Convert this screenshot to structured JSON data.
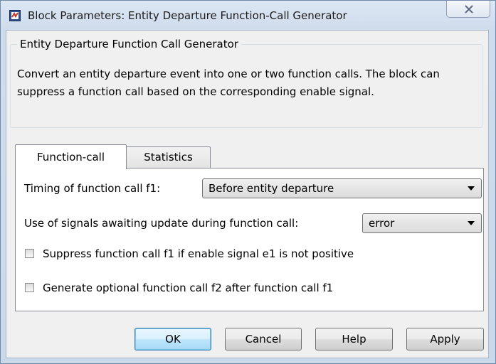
{
  "window": {
    "title": "Block Parameters: Entity Departure Function-Call Generator"
  },
  "description": {
    "group_title": "Entity Departure Function Call Generator",
    "text": "Convert an entity departure event into one or two function calls. The block can suppress a function call based on the corresponding enable signal."
  },
  "tabs": [
    {
      "label": "Function-call",
      "selected": true
    },
    {
      "label": "Statistics",
      "selected": false
    }
  ],
  "function_call_tab": {
    "timing": {
      "label": "Timing of function call f1:",
      "value": "Before entity departure"
    },
    "signals_update": {
      "label": "Use of signals awaiting update during function call:",
      "value": "error"
    },
    "suppress_f1": {
      "label": "Suppress function call f1 if enable signal e1 is not positive",
      "checked": false
    },
    "generate_f2": {
      "label": "Generate optional function call f2 after function call f1",
      "checked": false
    }
  },
  "buttons": {
    "ok": "OK",
    "cancel": "Cancel",
    "help": "Help",
    "apply": "Apply"
  },
  "icons": {
    "app": "simulink-block-icon",
    "close": "close-icon",
    "dropdown": "chevron-down-icon"
  }
}
